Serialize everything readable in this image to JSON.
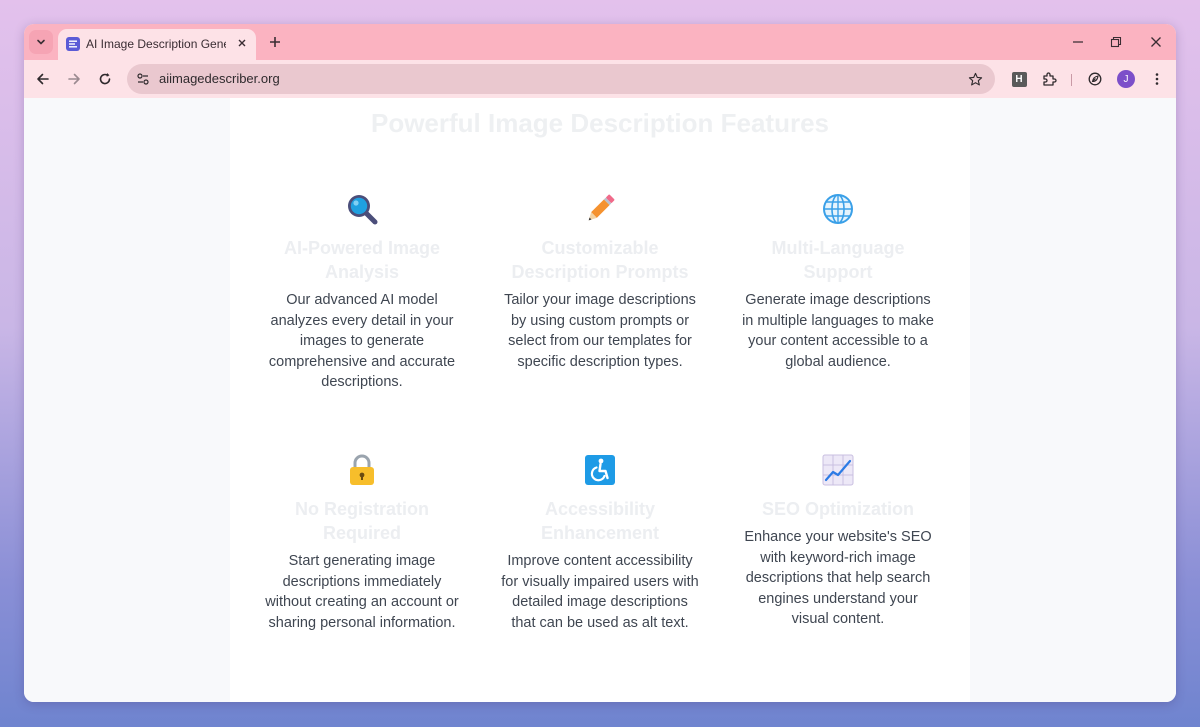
{
  "browser": {
    "tab_title": "AI Image Description Generator",
    "url": "aiimagedescriber.org",
    "profile_initial": "J",
    "extension_h_label": "H"
  },
  "page": {
    "section_title": "Powerful Image Description Features",
    "features": [
      {
        "icon": "magnifying-glass",
        "title": "AI-Powered Image Analysis",
        "description": "Our advanced AI model analyzes every detail in your images to generate comprehensive and accurate descriptions."
      },
      {
        "icon": "pencil",
        "title": "Customizable Description Prompts",
        "description": "Tailor your image descriptions by using custom prompts or select from our templates for specific description types."
      },
      {
        "icon": "globe",
        "title": "Multi-Language Support",
        "description": "Generate image descriptions in multiple languages to make your content accessible to a global audience."
      },
      {
        "icon": "lock",
        "title": "No Registration Required",
        "description": "Start generating image descriptions immediately without creating an account or sharing personal information."
      },
      {
        "icon": "wheelchair",
        "title": "Accessibility Enhancement",
        "description": "Improve content accessibility for visually impaired users with detailed image descriptions that can be used as alt text."
      },
      {
        "icon": "chart-increasing",
        "title": "SEO Optimization",
        "description": "Enhance your website's SEO with keyword-rich image descriptions that help search engines understand your visual content."
      }
    ]
  },
  "colors": {
    "tab_strip": "#fbb3c1",
    "toolbar": "#fde2e7",
    "omnibox": "#eac8cf",
    "feature_text": "#3f4651",
    "feature_title_faded": "#eceef1"
  }
}
